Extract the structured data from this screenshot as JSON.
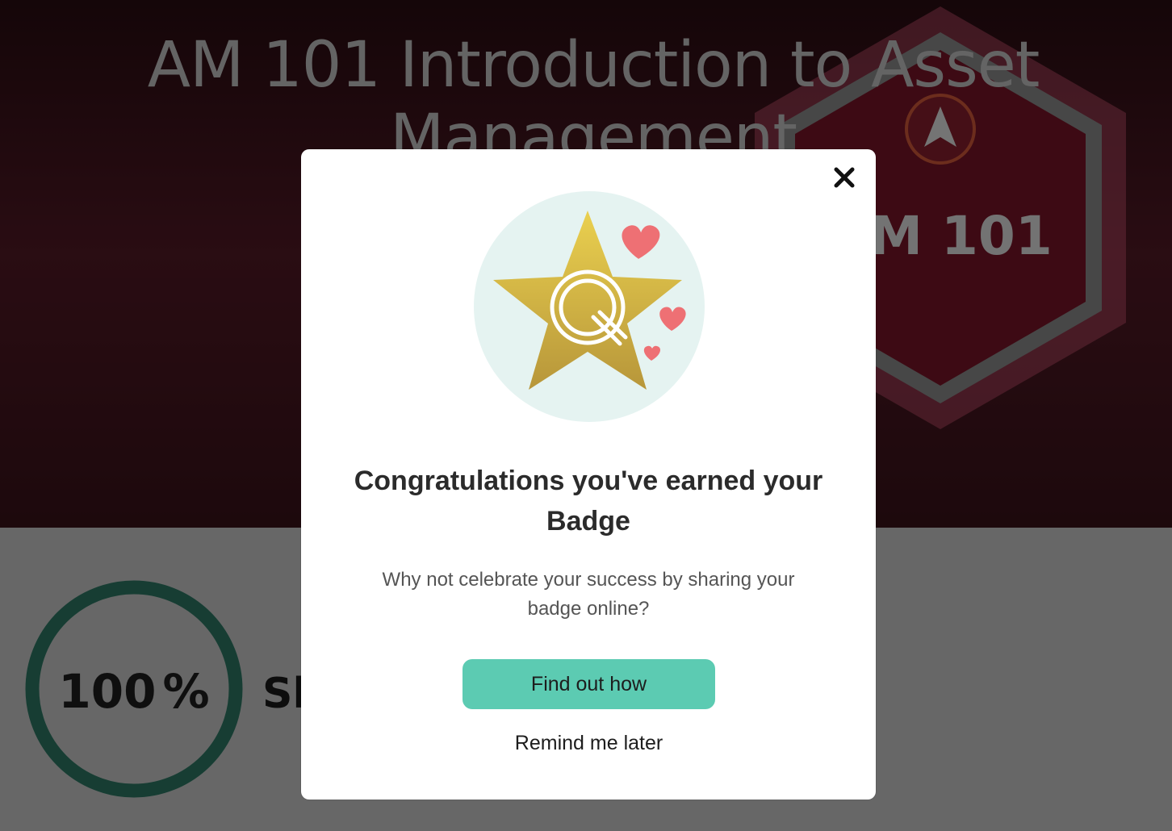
{
  "course": {
    "title": "AM 101 Introduction to Asset Management",
    "badge_text": "AM 101"
  },
  "progress": {
    "value": "100",
    "unit": "%",
    "fraction": 1.0
  },
  "share": {
    "heading_visible": "Sh"
  },
  "modal": {
    "close_icon": "close-icon",
    "title": "Congratulations you've earned your Badge",
    "text": "Why not celebrate your success by sharing your badge online?",
    "primary_button": "Find out how",
    "secondary_button": "Remind me later"
  },
  "colors": {
    "accent": "#5ccbb2",
    "hero_bg": "#541a26",
    "progress_ring": "#2e7b67"
  }
}
